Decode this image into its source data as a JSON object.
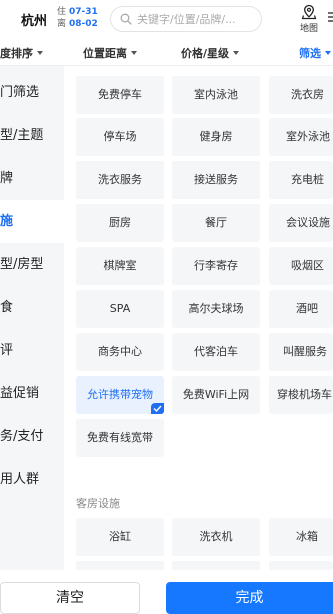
{
  "header": {
    "city": "杭州",
    "checkin_tag": "住",
    "checkin_date": "07-31",
    "checkout_tag": "离",
    "checkout_date": "08-02",
    "search_placeholder": "关键字/位置/品牌/...",
    "map_label": "地图"
  },
  "sort_tabs": [
    {
      "label": "度排序",
      "active": false
    },
    {
      "label": "位置距离",
      "active": false
    },
    {
      "label": "价格/星级",
      "active": false
    },
    {
      "label": "筛选",
      "active": true
    }
  ],
  "categories": [
    {
      "label": "门筛选",
      "active": false
    },
    {
      "label": "型/主题",
      "active": false
    },
    {
      "label": "牌",
      "active": false
    },
    {
      "label": "施",
      "active": true
    },
    {
      "label": "型/房型",
      "active": false
    },
    {
      "label": "食",
      "active": false
    },
    {
      "label": "评",
      "active": false
    },
    {
      "label": "益促销",
      "active": false
    },
    {
      "label": "务/支付",
      "active": false
    },
    {
      "label": "用人群",
      "active": false
    }
  ],
  "hotel_facilities": [
    [
      "免费停车",
      "室内泳池",
      "洗衣房"
    ],
    [
      "停车场",
      "健身房",
      "室外泳池"
    ],
    [
      "洗衣服务",
      "接送服务",
      "充电桩"
    ],
    [
      "厨房",
      "餐厅",
      "会议设施"
    ],
    [
      "棋牌室",
      "行李寄存",
      "吸烟区"
    ],
    [
      "SPA",
      "高尔夫球场",
      "酒吧"
    ],
    [
      "商务中心",
      "代客泊车",
      "叫醒服务"
    ],
    [
      "允许携带宠物",
      "免费WiFi上网",
      "穿梭机场车"
    ],
    [
      "免费有线宽带"
    ]
  ],
  "selected_option": "允许携带宠物",
  "room_facilities_title": "客房设施",
  "room_facilities": [
    "浴缸",
    "洗衣机",
    "冰箱"
  ],
  "footer": {
    "clear_label": "清空",
    "done_label": "完成"
  },
  "colors": {
    "accent": "#1f6ff5",
    "done_button": "#1677ff",
    "chip_bg": "#f5f6f8",
    "chip_selected_bg": "#e9f1ff"
  }
}
